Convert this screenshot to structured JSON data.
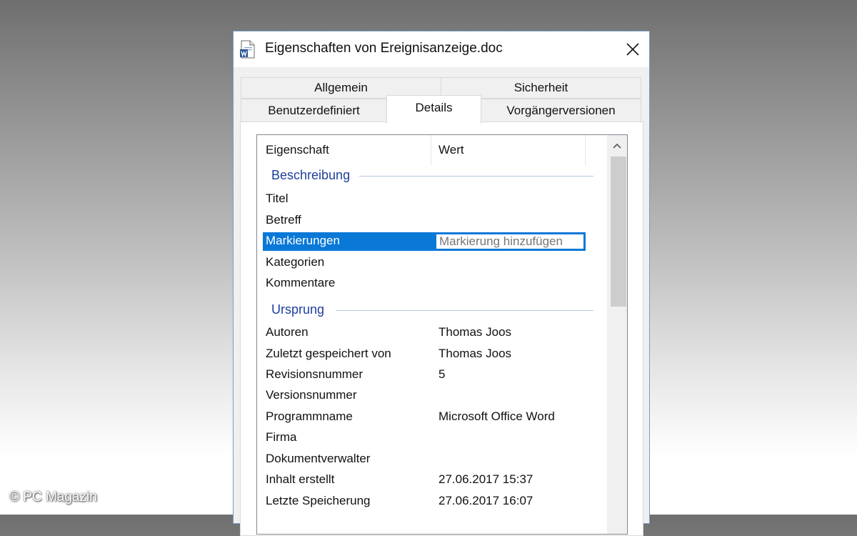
{
  "window": {
    "title": "Eigenschaften von Ereignisanzeige.doc"
  },
  "tabs": {
    "row1": [
      "Allgemein",
      "Sicherheit"
    ],
    "row2": [
      "Benutzerdefiniert",
      "Details",
      "Vorgängerversionen"
    ],
    "active": "Details"
  },
  "list": {
    "headers": {
      "property": "Eigenschaft",
      "value": "Wert"
    },
    "groups": [
      {
        "title": "Beschreibung",
        "rows": [
          {
            "name": "Titel",
            "value": ""
          },
          {
            "name": "Betreff",
            "value": ""
          },
          {
            "name": "Markierungen",
            "value": "",
            "placeholder": "Markierung hinzufügen",
            "selected": true
          },
          {
            "name": "Kategorien",
            "value": ""
          },
          {
            "name": "Kommentare",
            "value": ""
          }
        ]
      },
      {
        "title": "Ursprung",
        "rows": [
          {
            "name": "Autoren",
            "value": "Thomas Joos"
          },
          {
            "name": "Zuletzt gespeichert von",
            "value": "Thomas Joos"
          },
          {
            "name": "Revisionsnummer",
            "value": "5"
          },
          {
            "name": "Versionsnummer",
            "value": ""
          },
          {
            "name": "Programmname",
            "value": "Microsoft Office Word"
          },
          {
            "name": "Firma",
            "value": ""
          },
          {
            "name": "Dokumentverwalter",
            "value": ""
          },
          {
            "name": "Inhalt erstellt",
            "value": "27.06.2017 15:37"
          },
          {
            "name": "Letzte Speicherung",
            "value": "27.06.2017 16:07"
          }
        ]
      }
    ]
  },
  "watermark": "© PC Magazin",
  "colors": {
    "selection": "#0a78d7",
    "group_title": "#1e3f9c",
    "window_border": "#7a9cc4"
  },
  "icons": {
    "document": "word-document-icon",
    "close": "close-icon",
    "scroll_up": "chevron-up-icon"
  }
}
